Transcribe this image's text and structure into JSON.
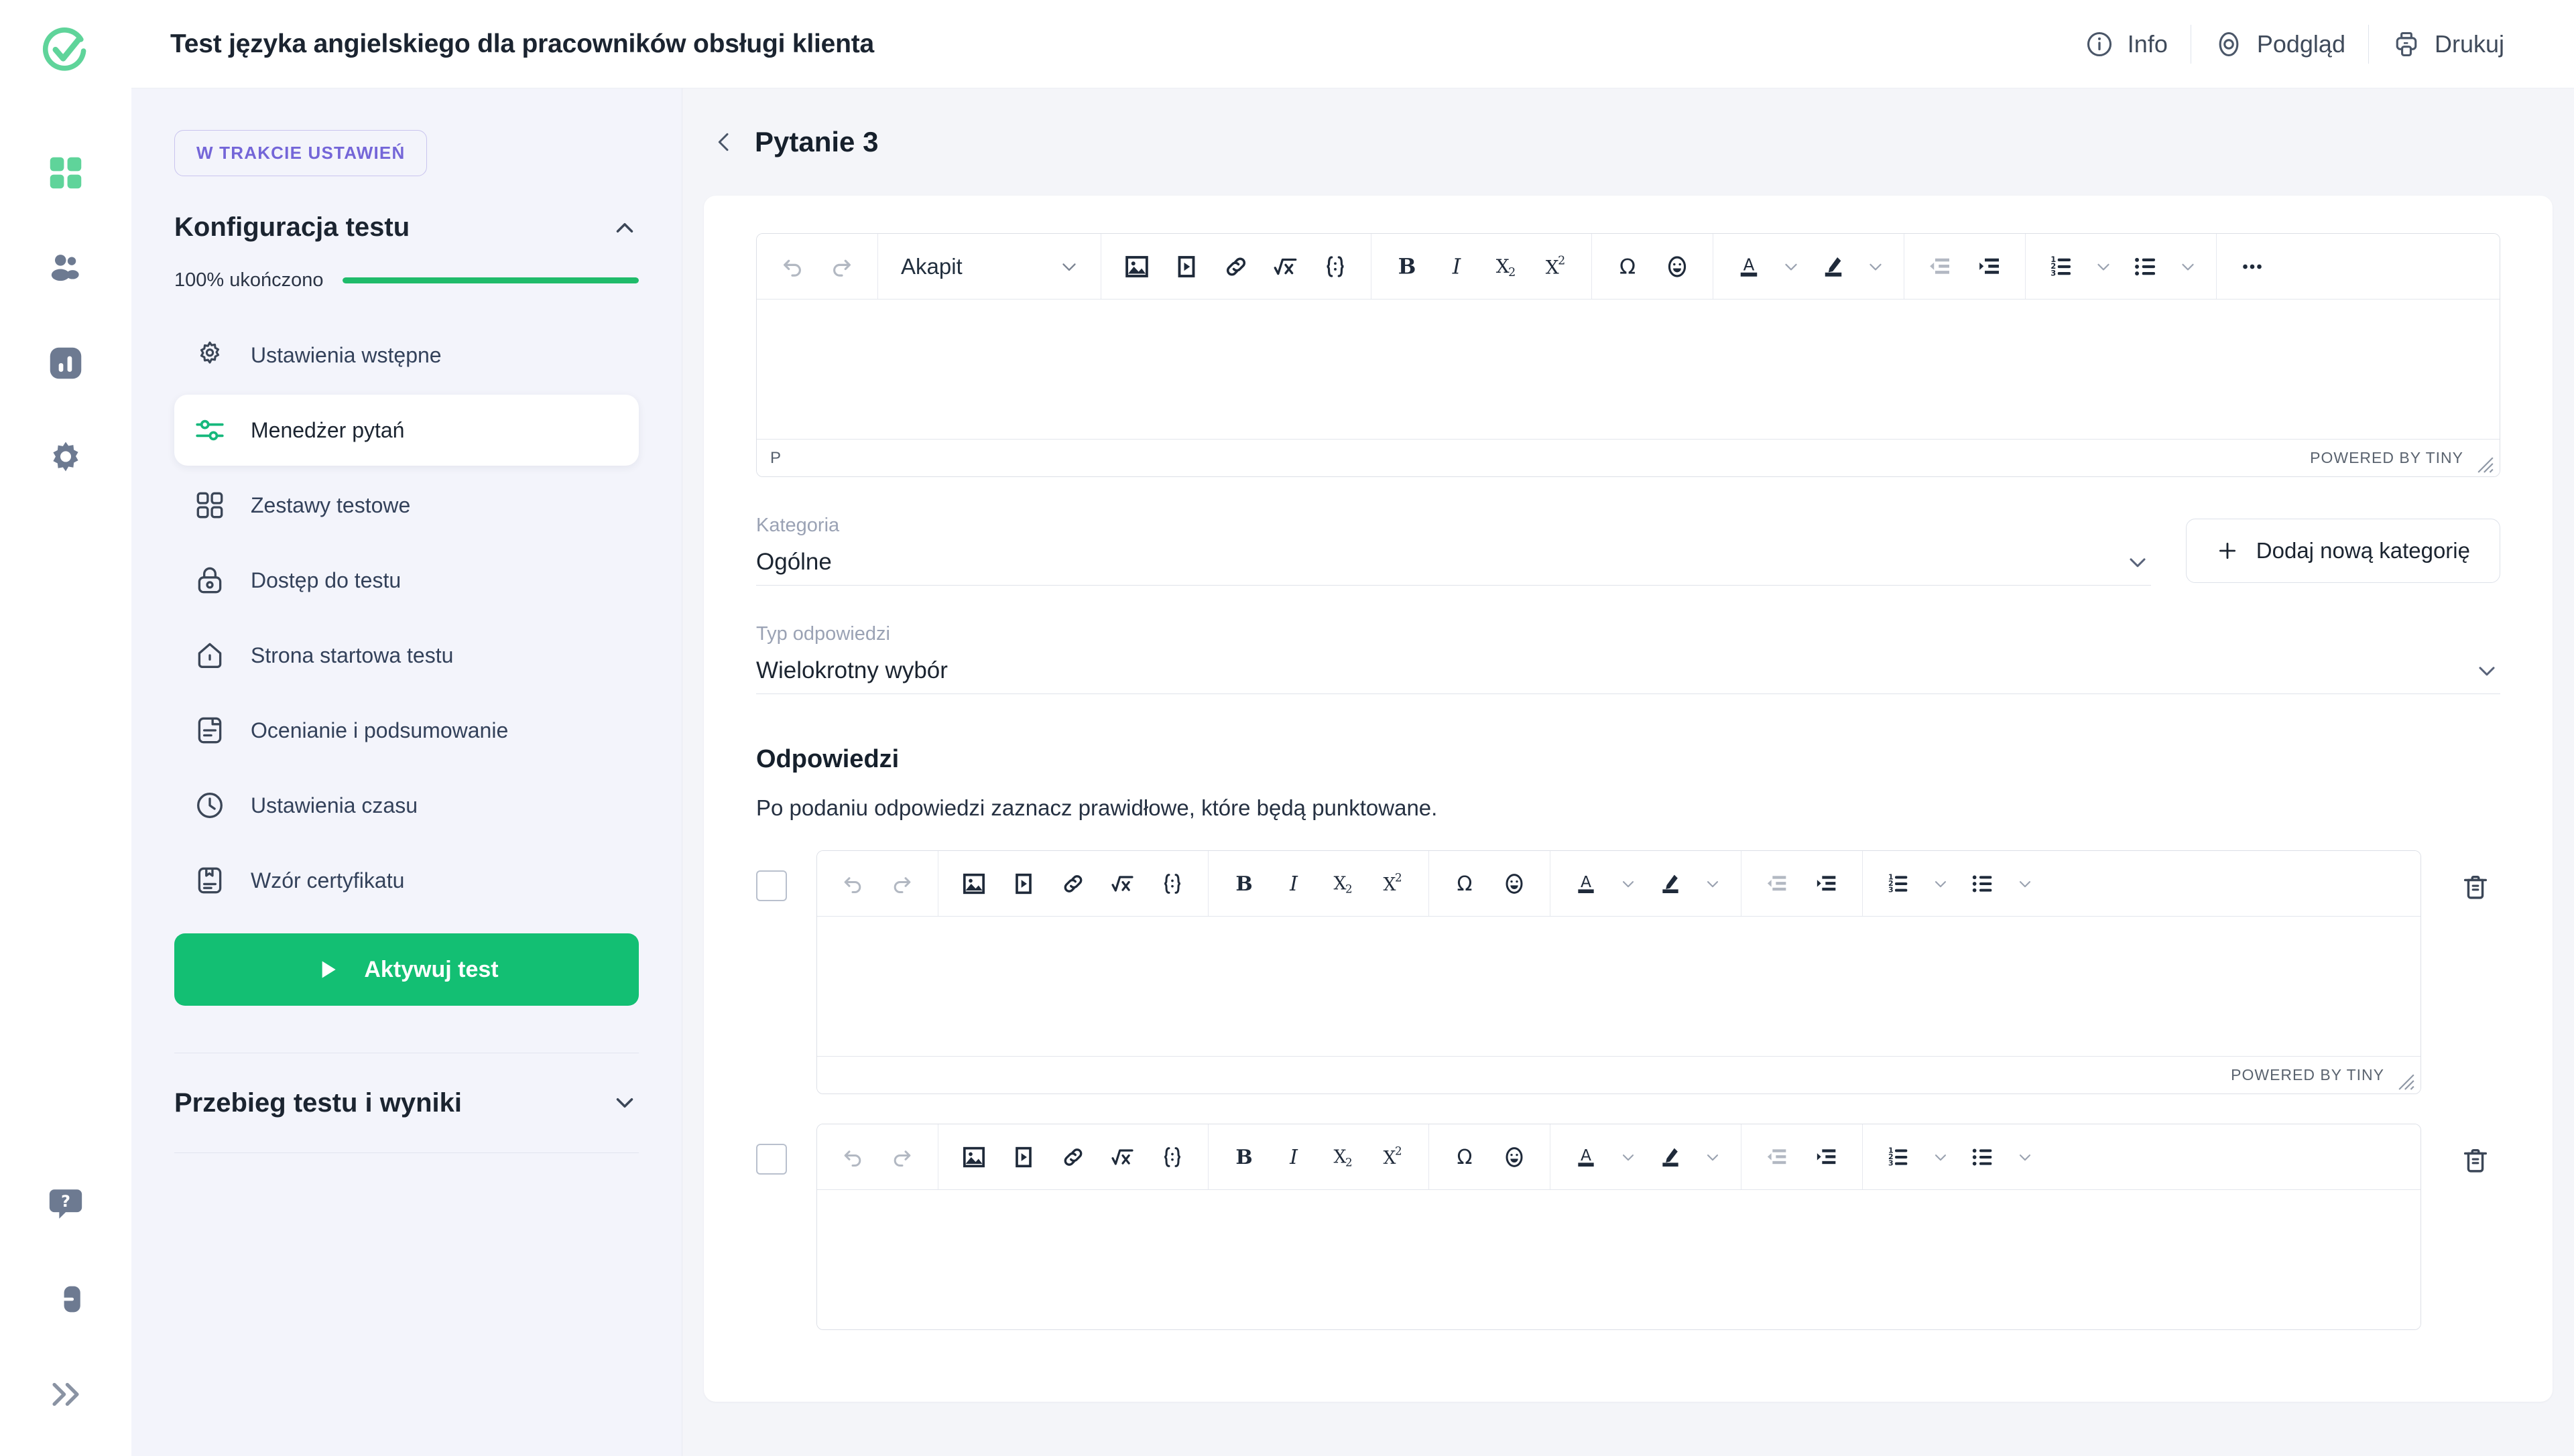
{
  "header": {
    "title": "Test języka angielskiego dla pracowników obsługi klienta",
    "actions": [
      {
        "label": "Info",
        "icon": "info-circle-icon"
      },
      {
        "label": "Podgląd",
        "icon": "eye-target-icon"
      },
      {
        "label": "Drukuj",
        "icon": "printer-icon"
      }
    ]
  },
  "rail": {
    "logo": "logo-checkmark-icon",
    "items": [
      {
        "icon": "dashboard-grid-icon",
        "active": true
      },
      {
        "icon": "users-icon",
        "active": false
      },
      {
        "icon": "reports-bar-icon",
        "active": false
      },
      {
        "icon": "settings-gear-icon",
        "active": false
      }
    ],
    "bottom": [
      {
        "icon": "help-question-icon"
      },
      {
        "icon": "logout-icon"
      },
      {
        "icon": "expand-chevrons-icon"
      }
    ]
  },
  "sidebar": {
    "status_badge": "W TRAKCIE USTAWIEŃ",
    "section_title": "Konfiguracja testu",
    "progress_label": "100% ukończono",
    "progress_percent": 100,
    "items": [
      {
        "label": "Ustawienia wstępne",
        "icon": "gear-icon",
        "active": false
      },
      {
        "label": "Menedżer pytań",
        "icon": "sliders-icon",
        "active": true
      },
      {
        "label": "Zestawy testowe",
        "icon": "grid-squares-icon",
        "active": false
      },
      {
        "label": "Dostęp do testu",
        "icon": "lock-icon",
        "active": false
      },
      {
        "label": "Strona startowa testu",
        "icon": "home-icon",
        "active": false
      },
      {
        "label": "Ocenianie i podsumowanie",
        "icon": "document-lines-icon",
        "active": false
      },
      {
        "label": "Ustawienia czasu",
        "icon": "clock-icon",
        "active": false
      },
      {
        "label": "Wzór certyfikatu",
        "icon": "certificate-icon",
        "active": false
      }
    ],
    "activate_button": "Aktywuj test",
    "activate_icon": "play-icon",
    "collapsed_section": "Przebieg testu i wyniki"
  },
  "main": {
    "back_icon": "chevron-left-icon",
    "page_title": "Pytanie 3",
    "question_editor": {
      "format_select": "Akapit",
      "status_path": "P",
      "brand": "POWERED BY TINY",
      "toolbar_groups": [
        {
          "buttons": [
            {
              "icon": "undo-icon",
              "disabled": true
            },
            {
              "icon": "redo-icon",
              "disabled": true
            }
          ]
        },
        {
          "select": "Akapit",
          "icon": "chevron-down-icon"
        },
        {
          "buttons": [
            {
              "icon": "insert-image-icon"
            },
            {
              "icon": "insert-media-icon"
            },
            {
              "icon": "insert-link-icon"
            },
            {
              "icon": "math-formula-icon"
            },
            {
              "icon": "source-code-icon"
            }
          ]
        },
        {
          "buttons": [
            {
              "icon": "bold-icon"
            },
            {
              "icon": "italic-icon"
            },
            {
              "icon": "subscript-icon"
            },
            {
              "icon": "superscript-icon"
            }
          ]
        },
        {
          "buttons": [
            {
              "icon": "special-character-icon"
            },
            {
              "icon": "emoticon-icon"
            }
          ]
        },
        {
          "buttons": [
            {
              "icon": "text-color-icon"
            },
            {
              "icon": "chevron-down-icon"
            },
            {
              "icon": "highlight-color-icon"
            },
            {
              "icon": "chevron-down-icon"
            }
          ]
        },
        {
          "buttons": [
            {
              "icon": "outdent-icon",
              "disabled": true
            },
            {
              "icon": "indent-icon"
            }
          ]
        },
        {
          "buttons": [
            {
              "icon": "numbered-list-icon"
            },
            {
              "icon": "chevron-down-icon"
            },
            {
              "icon": "bullet-list-icon"
            },
            {
              "icon": "chevron-down-icon"
            }
          ]
        },
        {
          "buttons": [
            {
              "icon": "more-options-icon"
            }
          ]
        }
      ]
    },
    "category": {
      "label": "Kategoria",
      "value": "Ogólne",
      "chevron": "chevron-down-icon",
      "add_button": "Dodaj nową kategorię",
      "add_icon": "plus-icon"
    },
    "answer_type": {
      "label": "Typ odpowiedzi",
      "value": "Wielokrotny wybór",
      "chevron": "chevron-down-icon"
    },
    "answers": {
      "title": "Odpowiedzi",
      "description": "Po podaniu odpowiedzi zaznacz prawidłowe, które będą punktowane.",
      "brand": "POWERED BY TINY",
      "delete_icon": "trash-icon",
      "checkbox_icon": "checkbox-unchecked-icon",
      "rows": [
        {
          "checked": false,
          "content": ""
        },
        {
          "checked": false,
          "content": ""
        }
      ]
    }
  },
  "colors": {
    "accent_green": "#13bf73",
    "badge_purple": "#7466d8",
    "sidebar_bg": "#f3f4fb",
    "text_dark": "#1b2430"
  }
}
